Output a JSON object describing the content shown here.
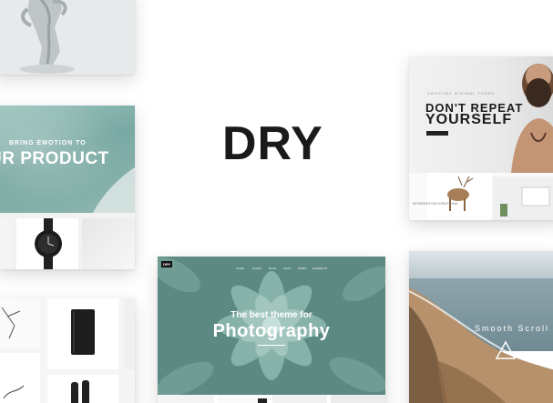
{
  "logo": {
    "text": "DRY"
  },
  "cards": {
    "sculpture": {
      "icon": "sculpture-image"
    },
    "emotion": {
      "kicker": "BRING EMOTION TO",
      "headline": "UR PRODUCT"
    },
    "dry_theme": {
      "tagline": "AWESOME MINIMAL THEME",
      "line1": "DON'T REPEAT",
      "line2": "YOURSELF",
      "caption": "INTERIOR DECORATIONS"
    },
    "photography": {
      "logo": "DRY",
      "nav": [
        "HOME",
        "PAGES",
        "BLOG",
        "SHOP",
        "WORK",
        "ELEMENTS"
      ],
      "subtitle": "The best theme for",
      "title": "Photography"
    },
    "beach": {
      "title": "Smooth Scroll"
    }
  },
  "colors": {
    "teal": "#7aa9a3",
    "agave": "#5f8c84",
    "dark": "#1a1a1a"
  }
}
